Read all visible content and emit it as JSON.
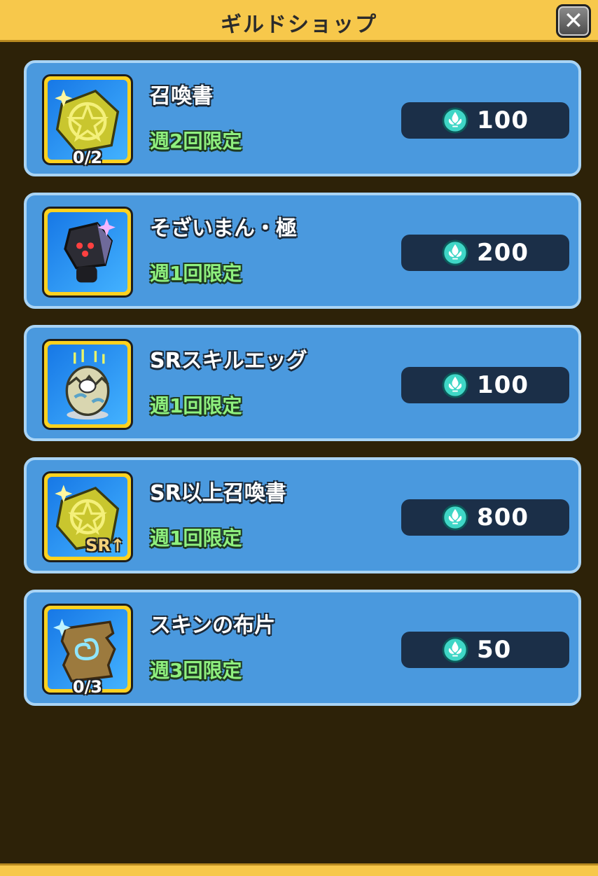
{
  "header": {
    "title": "ギルドショップ",
    "close_icon": "close-icon"
  },
  "colors": {
    "header": "#f7c84b",
    "card": "#4a99de",
    "limit_text": "#8ff07e",
    "price_box": "#1b2f48",
    "background": "#2d2208"
  },
  "items": [
    {
      "name": "召喚書",
      "limit": "週2回限定",
      "counter": "0/2",
      "price": "100",
      "icon": "summon-scroll-icon"
    },
    {
      "name": "そざいまん・極",
      "limit": "週1回限定",
      "counter": "",
      "price": "200",
      "icon": "material-man-icon"
    },
    {
      "name": "SRスキルエッグ",
      "limit": "週1回限定",
      "counter": "",
      "price": "100",
      "icon": "skill-egg-icon"
    },
    {
      "name": "SR以上召喚書",
      "limit": "週1回限定",
      "counter": "",
      "price": "800",
      "icon": "sr-summon-scroll-icon",
      "badge": "SR↑"
    },
    {
      "name": "スキンの布片",
      "limit": "週3回限定",
      "counter": "0/3",
      "price": "50",
      "icon": "skin-cloth-icon"
    }
  ],
  "currency_icon": "guild-coin-icon"
}
